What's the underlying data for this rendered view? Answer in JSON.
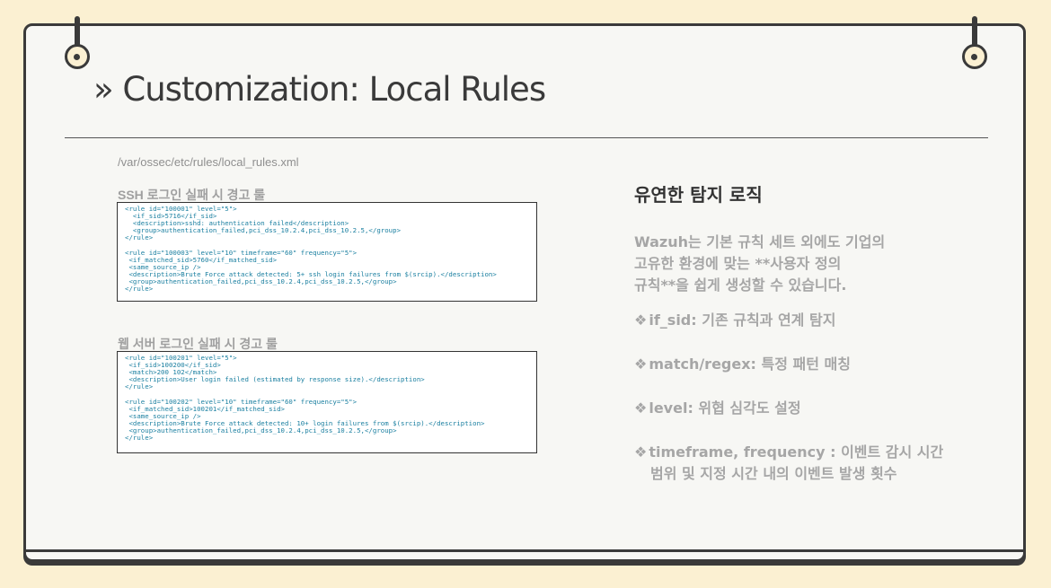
{
  "slide": {
    "title": "» Customization: Local Rules",
    "file_path": "/var/ossec/etc/rules/local_rules.xml"
  },
  "ssh_block": {
    "caption": "SSH 로그인 실패 시 경고 룰",
    "rule1": {
      "open": "<rule id=\"100001\" level=\"5\">",
      "if_sid": "<if_sid>5716</if_sid>",
      "description": "<description>sshd: authentication failed</description>",
      "group": "<group>authentication_failed,pci_dss_10.2.4,pci_dss_10.2.5,</group>",
      "close": "</rule>"
    },
    "rule2": {
      "open": "<rule id=\"100003\" level=\"10\" timeframe=\"60\" frequency=\"5\">",
      "if_matched_sid": "<if_matched_sid>5760</if_matched_sid>",
      "same_source_ip": "<same_source_ip />",
      "description": "<description>Brute Force attack detected: 5+ ssh login failures from $(srcip).</description>",
      "group": "<group>authentication_failed,pci_dss_10.2.4,pci_dss_10.2.5,</group>",
      "close": "</rule>"
    }
  },
  "web_block": {
    "caption": "웹 서버 로그인 실패 시 경고 룰",
    "rule1": {
      "open": "<rule id=\"100201\" level=\"5\">",
      "if_sid": "<if_sid>100200</if_sid>",
      "match": "<match>200 102</match>",
      "description": "<description>User login failed (estimated by response size).</description>",
      "close": "</rule>"
    },
    "rule2": {
      "open": "<rule id=\"100202\" level=\"10\" timeframe=\"60\" frequency=\"5\">",
      "if_matched_sid": "<if_matched_sid>100201</if_matched_sid>",
      "same_source_ip": "<same_source_ip />",
      "description": "<description>Brute Force attack detected: 10+ login failures from $(srcip).</description>",
      "group": "<group>authentication_failed,pci_dss_10.2.4,pci_dss_10.2.5,</group>",
      "close": "</rule>"
    }
  },
  "right_panel": {
    "heading": "유연한 탐지 로직",
    "intro_line1": "Wazuh는 기본 규칙 세트 외에도 기업의",
    "intro_line2": "고유한 환경에 맞는 **사용자 정의",
    "intro_line3": "규칙**을 쉽게 생성할 수 있습니다.",
    "bullet_symbol": "❖",
    "bullet1": "if_sid: 기존 규칙과 연계 탐지",
    "bullet2": "match/regex: 특정 패턴 매칭",
    "bullet3": "level: 위협 심각도 설정",
    "bullet4_line1": "timeframe, frequency : 이벤트 감시 시간",
    "bullet4_line2": "범위 및 지정 시간 내의 이벤트 발생 횟수"
  },
  "colors": {
    "background": "#fbf0d2",
    "board": "#f7f7f4",
    "border": "#3a3a3a",
    "xml_tag": "#1a7fa0",
    "xml_value": "#1c8a2a",
    "xml_keyword": "#c0392b"
  }
}
